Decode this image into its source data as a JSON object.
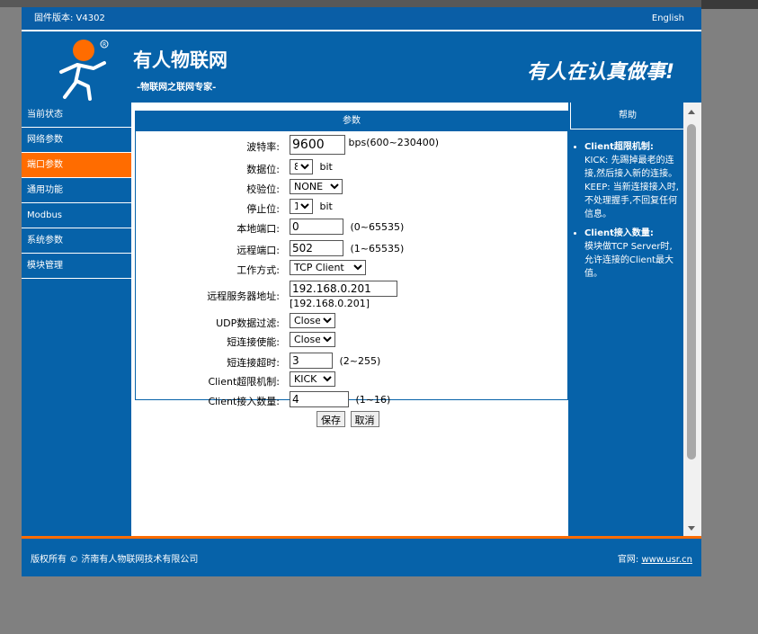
{
  "titlebar": {
    "firmware": "固件版本: V4302",
    "language": "English"
  },
  "header": {
    "brand_name": "有人物联网",
    "brand_sub": "-物联网之联网专家-",
    "slogan": "有人在认真做事!",
    "colors": {
      "brand_blue": "#0662a9",
      "accent_orange": "#ff6c00"
    }
  },
  "sidebar": {
    "items": [
      {
        "label": "当前状态"
      },
      {
        "label": "网络参数"
      },
      {
        "label": "端口参数",
        "active": true
      },
      {
        "label": "通用功能"
      },
      {
        "label": "Modbus"
      },
      {
        "label": "系统参数"
      },
      {
        "label": "模块管理"
      }
    ]
  },
  "panel": {
    "title": "参数",
    "baud": {
      "label": "波特率:",
      "value": "9600",
      "hint": "bps(600~230400)"
    },
    "data_bits": {
      "label": "数据位:",
      "value": "8",
      "unit": "bit"
    },
    "parity": {
      "label": "校验位:",
      "value": "NONE"
    },
    "stop_bits": {
      "label": "停止位:",
      "value": "1",
      "unit": "bit"
    },
    "local_port": {
      "label": "本地端口:",
      "value": "0",
      "hint": "(0~65535)"
    },
    "remote_port": {
      "label": "远程端口:",
      "value": "502",
      "hint": "(1~65535)"
    },
    "work_mode": {
      "label": "工作方式:",
      "value": "TCP Client"
    },
    "remote_addr": {
      "label": "远程服务器地址:",
      "value": "192.168.0.201",
      "resolved": "[192.168.0.201]"
    },
    "udp_filter": {
      "label": "UDP数据过滤:",
      "value": "Close"
    },
    "short_conn": {
      "label": "短连接使能:",
      "value": "Close"
    },
    "short_timeout": {
      "label": "短连接超时:",
      "value": "3",
      "hint": "(2~255)"
    },
    "client_limit": {
      "label": "Client超限机制:",
      "value": "KICK"
    },
    "client_count": {
      "label": "Client接入数量:",
      "value": "4",
      "hint": "(1~16)"
    }
  },
  "buttons": {
    "save": "保存",
    "cancel": "取消"
  },
  "help": {
    "title": "帮助",
    "item1_title": "Client超限机制:",
    "item1_kick": "KICK: 先踢掉最老的连接,然后接入新的连接。",
    "item1_keep": "KEEP: 当新连接接入时,不处理握手,不回复任何信息。",
    "item2_title": "Client接入数量:",
    "item2_text": "模块做TCP Server时,允许连接的Client最大值。"
  },
  "footer": {
    "copyright": "版权所有 © 济南有人物联网技术有限公司",
    "site_label": "官网:",
    "site_link": "www.usr.cn"
  }
}
